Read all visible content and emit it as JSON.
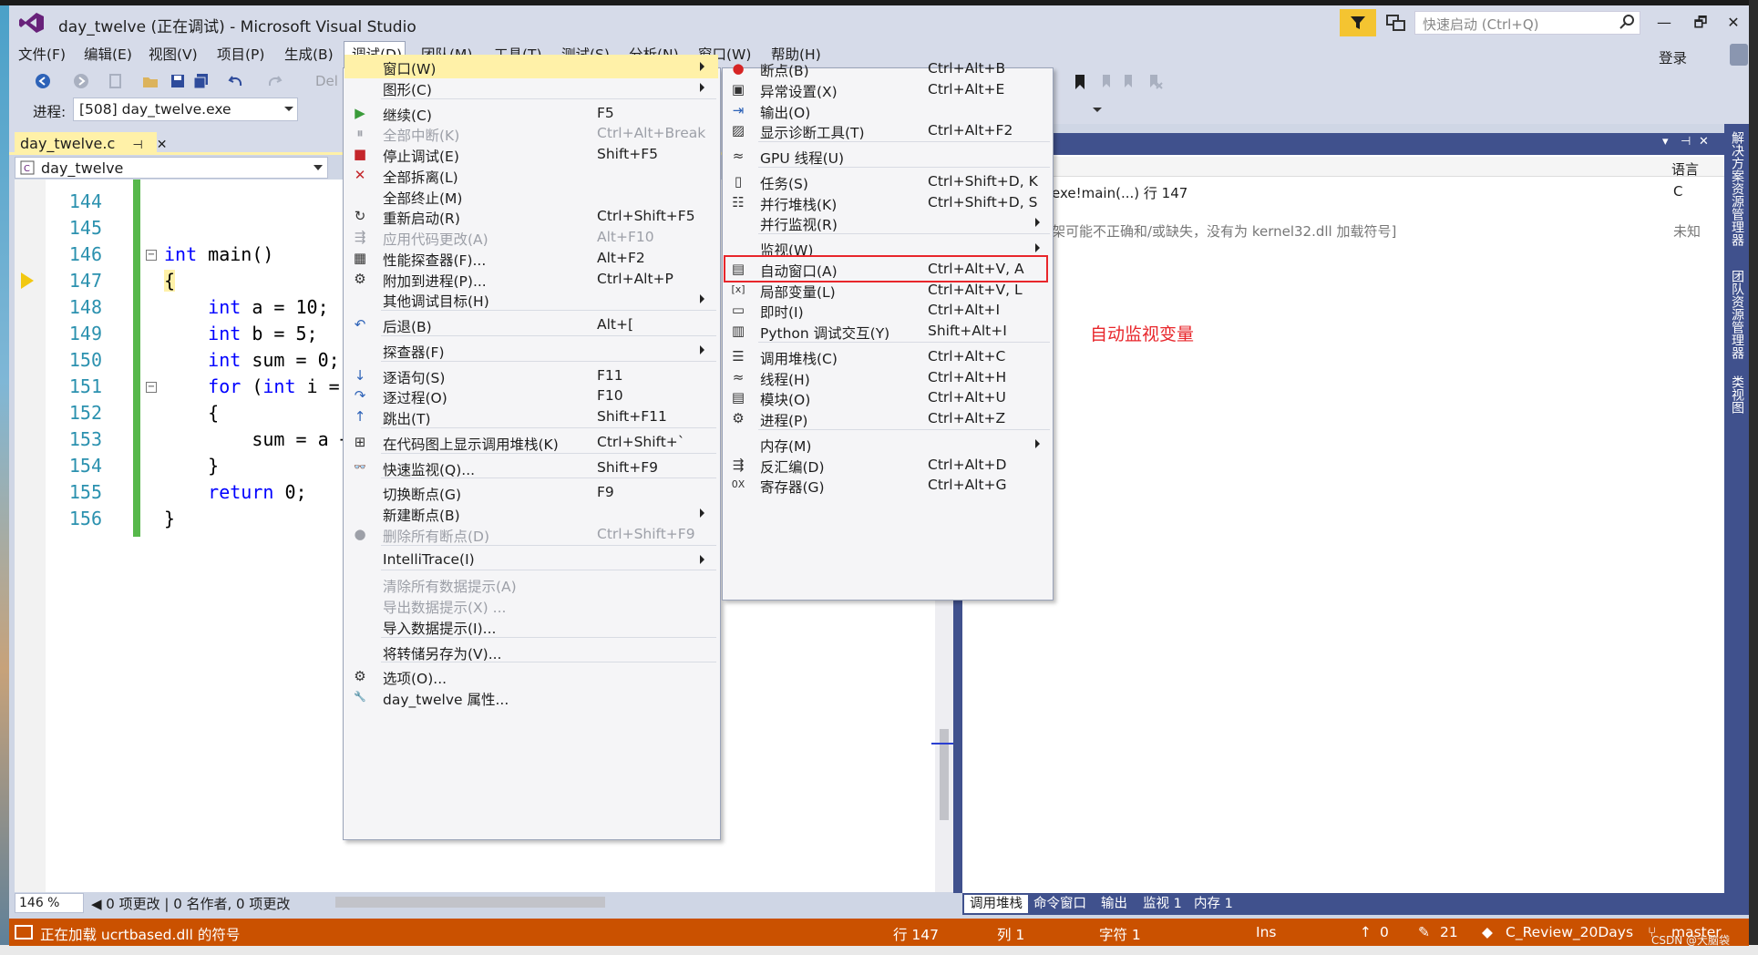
{
  "title": {
    "text": "day_twelve (正在调试) - Microsoft Visual Studio",
    "quick_launch_placeholder": "快速启动 (Ctrl+Q)",
    "minimize": "—",
    "restore": "🗗",
    "close": "✕"
  },
  "menubar": {
    "items": [
      "文件(F)",
      "编辑(E)",
      "视图(V)",
      "项目(P)",
      "生成(B)",
      "调试(D)",
      "团队(M)",
      "工具(T)",
      "测试(S)",
      "分析(N)",
      "窗口(W)",
      "帮助(H)"
    ],
    "signin": "登录"
  },
  "toolbar": {
    "process_label": "进程:",
    "process_value": "[508] day_twelve.exe",
    "partial_text": "Del"
  },
  "editor": {
    "tab_label": "day_twelve.c",
    "nav_value": "day_twelve",
    "lines": [
      {
        "no": "144",
        "code": ""
      },
      {
        "no": "145",
        "code": ""
      },
      {
        "no": "146",
        "code": "int main()"
      },
      {
        "no": "147",
        "code": "{"
      },
      {
        "no": "148",
        "code": "    int a = 10;"
      },
      {
        "no": "149",
        "code": "    int b = 5;"
      },
      {
        "no": "150",
        "code": "    int sum = 0;"
      },
      {
        "no": "151",
        "code": "    for (int i ="
      },
      {
        "no": "152",
        "code": "    {"
      },
      {
        "no": "153",
        "code": "        sum = a +"
      },
      {
        "no": "154",
        "code": "    }"
      },
      {
        "no": "155",
        "code": "    return 0;"
      },
      {
        "no": "156",
        "code": "}"
      }
    ],
    "zoom": "146 %",
    "codelens": "◀ 0 项更改 | 0 名作者, 0 项更改"
  },
  "debug_menu": {
    "items": [
      {
        "label": "窗口(W)",
        "key": "",
        "icon": "",
        "submenu": true,
        "highlight": true
      },
      {
        "label": "图形(C)",
        "key": "",
        "icon": "",
        "submenu": true
      },
      {
        "sep": true
      },
      {
        "label": "继续(C)",
        "key": "F5",
        "icon": "▶",
        "icon_color": "#3a9b3a"
      },
      {
        "label": "全部中断(K)",
        "key": "Ctrl+Alt+Break",
        "icon": "⏸",
        "disabled": true
      },
      {
        "label": "停止调试(E)",
        "key": "Shift+F5",
        "icon": "■",
        "icon_color": "#c4262b"
      },
      {
        "label": "全部拆离(L)",
        "key": "",
        "icon": "✕",
        "icon_color": "#c4262b"
      },
      {
        "label": "全部终止(M)",
        "key": "",
        "icon": ""
      },
      {
        "label": "重新启动(R)",
        "key": "Ctrl+Shift+F5",
        "icon": "↻"
      },
      {
        "label": "应用代码更改(A)",
        "key": "Alt+F10",
        "icon": "⇶",
        "disabled": true
      },
      {
        "label": "性能探查器(F)...",
        "key": "Alt+F2",
        "icon": "▦"
      },
      {
        "label": "附加到进程(P)...",
        "key": "Ctrl+Alt+P",
        "icon": "⚙"
      },
      {
        "label": "其他调试目标(H)",
        "key": "",
        "icon": "",
        "submenu": true
      },
      {
        "sep": true
      },
      {
        "label": "后退(B)",
        "key": "Alt+[",
        "icon": "↶",
        "icon_color": "#2e63b8"
      },
      {
        "sep": true
      },
      {
        "label": "探查器(F)",
        "key": "",
        "icon": "",
        "submenu": true
      },
      {
        "sep": true
      },
      {
        "label": "逐语句(S)",
        "key": "F11",
        "icon": "↓",
        "icon_color": "#2e63b8"
      },
      {
        "label": "逐过程(O)",
        "key": "F10",
        "icon": "↷",
        "icon_color": "#2e63b8"
      },
      {
        "label": "跳出(T)",
        "key": "Shift+F11",
        "icon": "↑",
        "icon_color": "#2e63b8"
      },
      {
        "sep": true
      },
      {
        "label": "在代码图上显示调用堆栈(K)",
        "key": "Ctrl+Shift+`",
        "icon": "⊞"
      },
      {
        "sep": true
      },
      {
        "label": "快速监视(Q)...",
        "key": "Shift+F9",
        "icon": "👓"
      },
      {
        "sep": true
      },
      {
        "label": "切换断点(G)",
        "key": "F9",
        "icon": ""
      },
      {
        "label": "新建断点(B)",
        "key": "",
        "icon": "",
        "submenu": true
      },
      {
        "label": "删除所有断点(D)",
        "key": "Ctrl+Shift+F9",
        "icon": "●",
        "disabled": true
      },
      {
        "sep": true
      },
      {
        "label": "IntelliTrace(I)",
        "key": "",
        "icon": "",
        "submenu": true
      },
      {
        "sep": true
      },
      {
        "label": "清除所有数据提示(A)",
        "key": "",
        "icon": "",
        "disabled": true
      },
      {
        "label": "导出数据提示(X) ...",
        "key": "",
        "icon": "",
        "disabled": true
      },
      {
        "label": "导入数据提示(I)...",
        "key": "",
        "icon": ""
      },
      {
        "sep": true
      },
      {
        "label": "将转储另存为(V)...",
        "key": "",
        "icon": ""
      },
      {
        "sep": true
      },
      {
        "label": "选项(O)...",
        "key": "",
        "icon": "⚙"
      },
      {
        "label": "day_twelve 属性...",
        "key": "",
        "icon": "🔧"
      }
    ]
  },
  "window_submenu": {
    "items": [
      {
        "label": "断点(B)",
        "key": "Ctrl+Alt+B",
        "icon": "●",
        "icon_color": "#d62424"
      },
      {
        "label": "异常设置(X)",
        "key": "Ctrl+Alt+E",
        "icon": "▣"
      },
      {
        "label": "输出(O)",
        "key": "",
        "icon": "⇥",
        "icon_color": "#2e63b8"
      },
      {
        "label": "显示诊断工具(T)",
        "key": "Ctrl+Alt+F2",
        "icon": "▨"
      },
      {
        "sep": true
      },
      {
        "label": "GPU 线程(U)",
        "key": "",
        "icon": "≈"
      },
      {
        "sep": true
      },
      {
        "label": "任务(S)",
        "key": "Ctrl+Shift+D, K",
        "icon": "▯"
      },
      {
        "label": "并行堆栈(K)",
        "key": "Ctrl+Shift+D, S",
        "icon": "☷"
      },
      {
        "label": "并行监视(R)",
        "key": "",
        "icon": "",
        "submenu": true
      },
      {
        "sep": true
      },
      {
        "label": "监视(W)",
        "key": "",
        "icon": "",
        "submenu": true
      },
      {
        "label": "自动窗口(A)",
        "key": "Ctrl+Alt+V, A",
        "icon": "▤",
        "highlight": true
      },
      {
        "label": "局部变量(L)",
        "key": "Ctrl+Alt+V, L",
        "icon": "[x]"
      },
      {
        "label": "即时(I)",
        "key": "Ctrl+Alt+I",
        "icon": "▭"
      },
      {
        "label": "Python 调试交互(Y)",
        "key": "Shift+Alt+I",
        "icon": "▥"
      },
      {
        "sep": true
      },
      {
        "label": "调用堆栈(C)",
        "key": "Ctrl+Alt+C",
        "icon": "☰"
      },
      {
        "label": "线程(H)",
        "key": "Ctrl+Alt+H",
        "icon": "≈"
      },
      {
        "label": "模块(O)",
        "key": "Ctrl+Alt+U",
        "icon": "▤"
      },
      {
        "label": "进程(P)",
        "key": "Ctrl+Alt+Z",
        "icon": "⚙"
      },
      {
        "sep": true
      },
      {
        "label": "内存(M)",
        "key": "",
        "icon": "",
        "submenu": true
      },
      {
        "label": "反汇编(D)",
        "key": "Ctrl+Alt+D",
        "icon": "⇶"
      },
      {
        "label": "寄存器(G)",
        "key": "Ctrl+Alt+G",
        "icon": "0X"
      }
    ]
  },
  "right_panel": {
    "lang_header": "语言",
    "row1_text": "exe!main(...) 行 147",
    "row1_lang": "C",
    "row2_text": "架可能不正确和/或缺失，没有为 kernel32.dll 加载符号]",
    "row2_lang": "未知",
    "annotation": "自动监视变量"
  },
  "bottom_tabs": [
    "调用堆栈",
    "命令窗口",
    "输出",
    "监视 1",
    "内存 1"
  ],
  "side_strip": [
    "解决方案资源管理器",
    "团队资源管理器",
    "类视图"
  ],
  "statusbar": {
    "message": "正在加载 ucrtbased.dll 的符号",
    "row": "行 147",
    "col": "列 1",
    "char": "字符 1",
    "mode": "Ins",
    "up": "0",
    "edits": "21",
    "repo": "C_Review_20Days",
    "branch": "master",
    "watermark": "CSDN @大脑袋"
  },
  "colors": {
    "accent": "#40518d",
    "status": "#ca5100",
    "highlight": "#fff1a8",
    "annotation": "#e8262b"
  }
}
